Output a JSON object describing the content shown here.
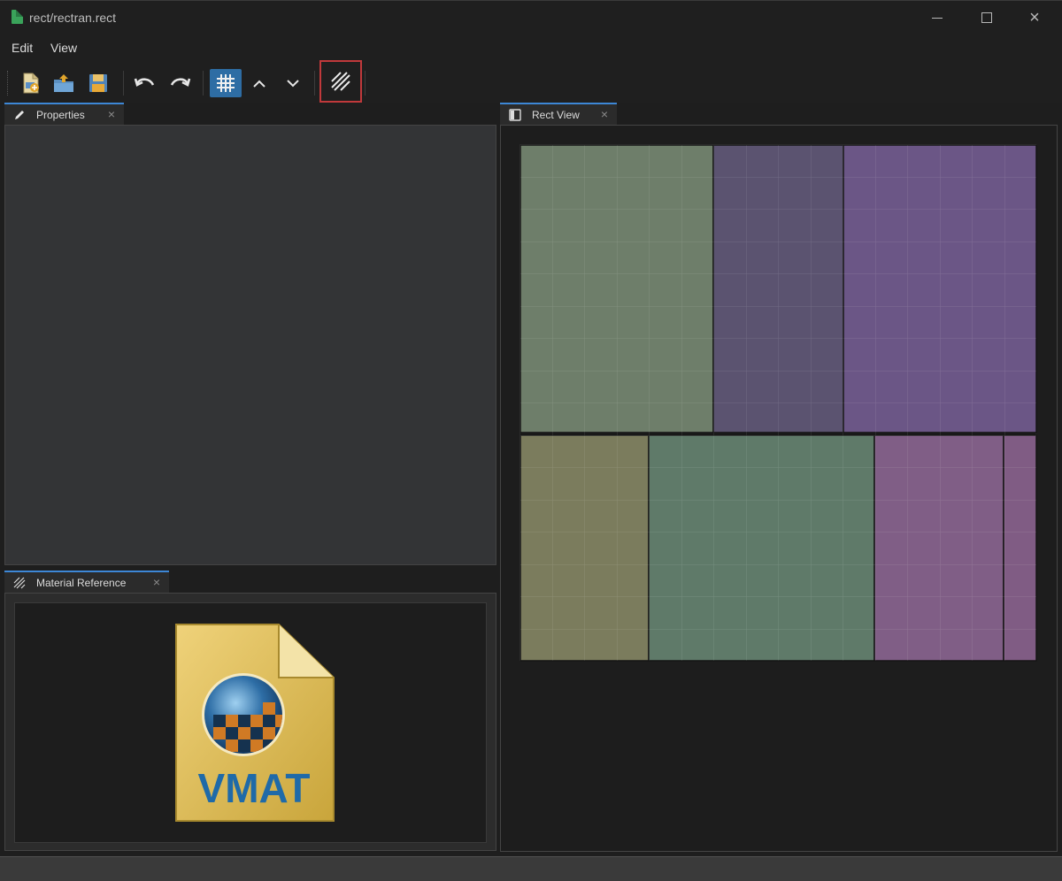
{
  "window": {
    "title": "rect/rectran.rect",
    "app_icon": "rect-file-icon",
    "controls": [
      "minimize-icon",
      "maximize-icon",
      "close-icon"
    ]
  },
  "menu": {
    "edit": "Edit",
    "view": "View"
  },
  "toolbar": {
    "buttons": [
      {
        "icon": "new-file-icon"
      },
      {
        "icon": "open-folder-icon"
      },
      {
        "icon": "save-icon"
      },
      {
        "icon": "undo-icon"
      },
      {
        "icon": "redo-icon"
      },
      {
        "icon": "grid-icon",
        "active": true
      },
      {
        "icon": "chevron-up-icon"
      },
      {
        "icon": "chevron-down-icon"
      },
      {
        "icon": "hatch-icon",
        "highlighted": true
      }
    ],
    "accent": "#2e6da4",
    "highlight_color": "#c0393b"
  },
  "panels": {
    "properties": {
      "label": "Properties",
      "icon": "pencil-icon",
      "close": "×"
    },
    "material_reference": {
      "label": "Material Reference",
      "icon": "hatch-icon",
      "close": "×",
      "image_label": "VMAT"
    },
    "rect_view": {
      "label": "Rect View",
      "icon": "panel-icon",
      "close": "×"
    }
  },
  "rects": [
    {
      "color": "#6e7e6a"
    },
    {
      "color": "#5b5370"
    },
    {
      "color": "#6b5686"
    },
    {
      "color": "#7b7c5d"
    },
    {
      "color": "#5f7a69"
    },
    {
      "color": "#805e86"
    },
    {
      "color": "#805c84"
    }
  ]
}
